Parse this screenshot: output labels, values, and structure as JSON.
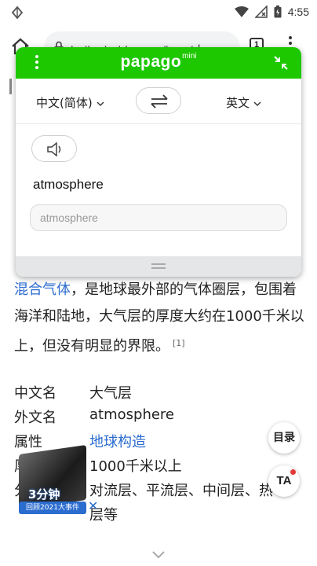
{
  "status_bar": {
    "time": "4:55"
  },
  "browser": {
    "url": "baike.baidu.com/item/大",
    "tab_count": "1"
  },
  "papago": {
    "logo": "papago",
    "logo_sup": "mini",
    "source_lang": "中文(简体)",
    "target_lang": "英文",
    "source_text": "atmosphere",
    "result_text": "atmosphere",
    "accent_color": "#1ec800"
  },
  "article": {
    "link_text": "混合气体",
    "body_text": "，是地球最外部的气体圈层，包围着海洋和陆地，大气层的厚度大约在1000千米以上，但没有明显的界限。",
    "citation": "[1]"
  },
  "infobox": {
    "rows": [
      {
        "key": "中文名",
        "value": "大气层"
      },
      {
        "key": "外文名",
        "value": "atmosphere"
      },
      {
        "key": "属性",
        "value": "地球构造"
      },
      {
        "key": "厚",
        "value": "1000千米以上"
      },
      {
        "key": "分",
        "value": "对流层、平流层、中间层、热"
      }
    ],
    "continuation": "层等"
  },
  "floating": {
    "toc_label": "目录",
    "translate_label": "TA"
  },
  "ad": {
    "title": "3分钟",
    "subtitle": "回顾2021大事件",
    "close": "✕"
  }
}
